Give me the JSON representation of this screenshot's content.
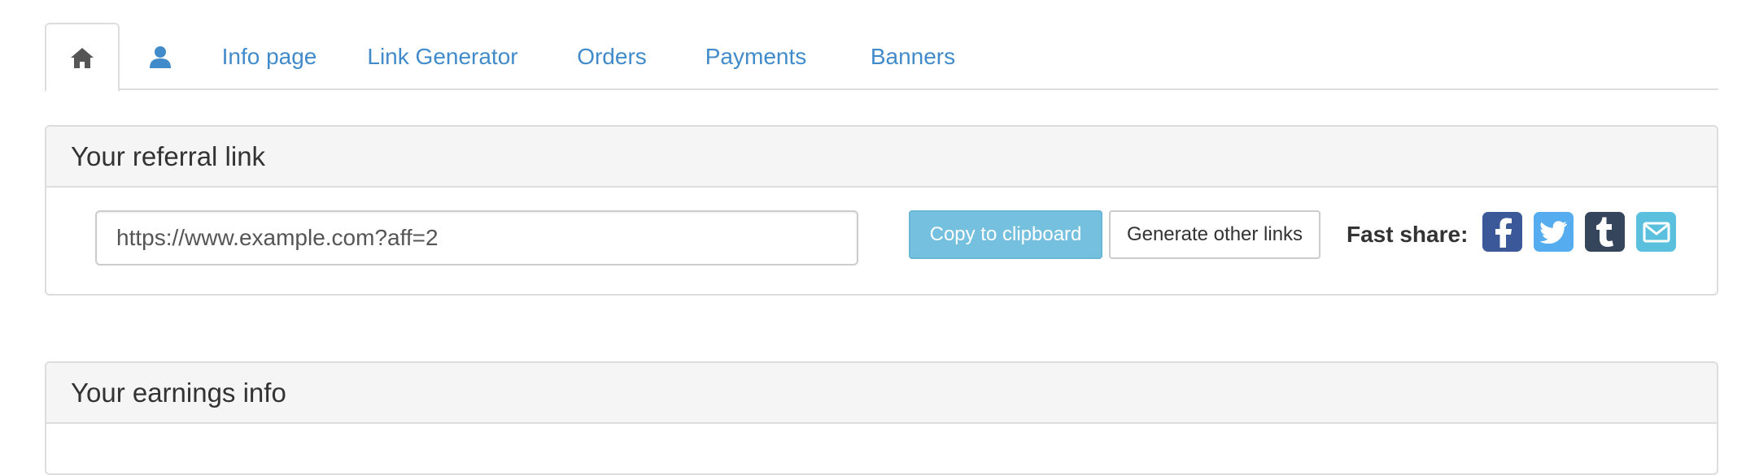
{
  "tabs": {
    "home_icon": "home-icon",
    "user_icon": "user-icon",
    "items": [
      {
        "label": "Info page"
      },
      {
        "label": "Link Generator"
      },
      {
        "label": "Orders"
      },
      {
        "label": "Payments"
      },
      {
        "label": "Banners"
      }
    ]
  },
  "referral": {
    "title": "Your referral link",
    "link_value": "https://www.example.com?aff=2",
    "copy_label": "Copy to clipboard",
    "generate_label": "Generate other links",
    "fast_share_label": "Fast share:",
    "share_icons": [
      "facebook-icon",
      "twitter-icon",
      "tumblr-icon",
      "email-icon"
    ]
  },
  "earnings": {
    "title": "Your earnings info"
  },
  "colors": {
    "link": "#428bca",
    "copy_button": "#75c0de",
    "facebook": "#3b5998",
    "twitter": "#55acee",
    "tumblr": "#35465c",
    "email": "#5bc0de"
  }
}
